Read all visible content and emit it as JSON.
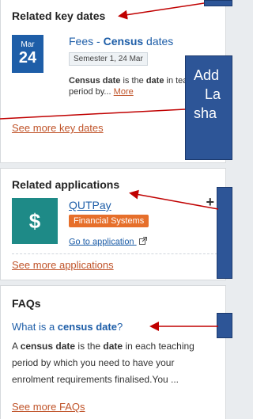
{
  "key_dates": {
    "title": "Related key dates",
    "date_month": "Mar",
    "date_day": "24",
    "item_title_pre": "Fees - ",
    "item_title_bold": "Census",
    "item_title_post": " dates",
    "chip": "Semester 1, 24 Mar",
    "desc_bold1": "Census date",
    "desc_mid": " is the ",
    "desc_bold2": "date",
    "desc_tail": " in teaching period by...",
    "more_label": "More",
    "see_more": "See more key dates"
  },
  "applications": {
    "title": "Related applications",
    "app_icon": "$",
    "app_name": "QUTPay",
    "app_tag": "Financial Systems",
    "go_label": "Go to application",
    "plus": "+",
    "see_more": "See more applications"
  },
  "faqs": {
    "title": "FAQs",
    "q_pre": "What is a ",
    "q_bold": "census date",
    "q_post": "?",
    "a_pre": "A ",
    "a_bold1": "census date",
    "a_mid": " is the ",
    "a_bold2": "date",
    "a_tail": " in each teaching period by which you need to have your enrolment requirements finalised.You ...",
    "see_more": "See more FAQs"
  },
  "callout": {
    "line1": "Add",
    "line2": "La",
    "line3": "sha"
  },
  "colors": {
    "accent_blue": "#1e5ea8",
    "orange_link": "#c0542a",
    "tag_orange": "#e66f2b",
    "app_teal": "#1e8a87",
    "callout_blue": "#2d5597",
    "arrow_red": "#c00000"
  }
}
